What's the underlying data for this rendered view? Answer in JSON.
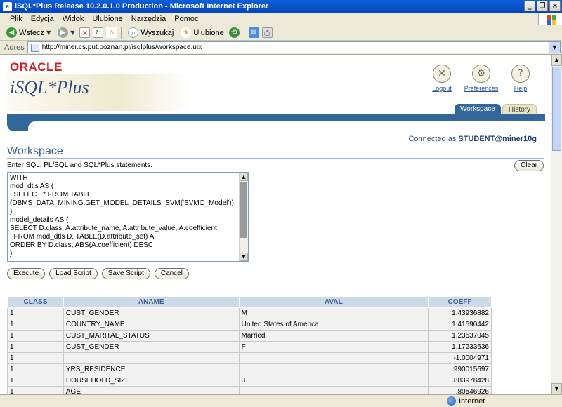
{
  "window": {
    "title": "iSQL*Plus Release 10.2.0.1.0 Production - Microsoft Internet Explorer",
    "buttons": [
      "_",
      "❐",
      "×"
    ]
  },
  "menu": [
    "Plik",
    "Edycja",
    "Widok",
    "Ulubione",
    "Narzędzia",
    "Pomoc"
  ],
  "toolbar": {
    "back": "Wstecz",
    "search": "Wyszukaj",
    "favorites": "Ulubione"
  },
  "address": {
    "label": "Adres",
    "url": "http://miner.cs.put.poznan.pl/isqlplus/workspace.uix"
  },
  "header": {
    "brand": "ORACLE",
    "product": "iSQL*Plus",
    "links": [
      "Logout",
      "Preferences",
      "Help"
    ],
    "tabs": [
      "Workspace",
      "History"
    ],
    "connected_prefix": "Connected as",
    "connected_user": "STUDENT@miner10g"
  },
  "workspace": {
    "title": "Workspace",
    "instruction": "Enter SQL, PL/SQL and SQL*Plus statements.",
    "clear_label": "Clear",
    "sql": "WITH\nmod_dtls AS (\n  SELECT * FROM TABLE\n(DBMS_DATA_MINING.GET_MODEL_DETAILS_SVM('SVMO_Model'))\n),\nmodel_details AS (\nSELECT D.class, A.attribute_name, A.attribute_value, A.coefficient\n  FROM mod_dtls D, TABLE(D.attribute_set) A\nORDER BY D.class, ABS(A.coefficient) DESC\n)",
    "buttons": [
      "Execute",
      "Load Script",
      "Save Script",
      "Cancel"
    ]
  },
  "results": {
    "columns": [
      "CLASS",
      "ANAME",
      "AVAL",
      "COEFF"
    ],
    "rows": [
      [
        "1",
        "CUST_GENDER",
        "M",
        "1.43936882"
      ],
      [
        "1",
        "COUNTRY_NAME",
        "United States of America",
        "1.41590442"
      ],
      [
        "1",
        "CUST_MARITAL_STATUS",
        "Married",
        "1.23537045"
      ],
      [
        "1",
        "CUST_GENDER",
        "F",
        "1.17233636"
      ],
      [
        "1",
        "",
        "",
        "-1.0004971"
      ],
      [
        "1",
        "YRS_RESIDENCE",
        "",
        ".990015697"
      ],
      [
        "1",
        "HOUSEHOLD_SIZE",
        "3",
        ".883978428"
      ],
      [
        "1",
        "AGE",
        "",
        ".80546926"
      ]
    ]
  },
  "status": {
    "zone": "Internet"
  }
}
